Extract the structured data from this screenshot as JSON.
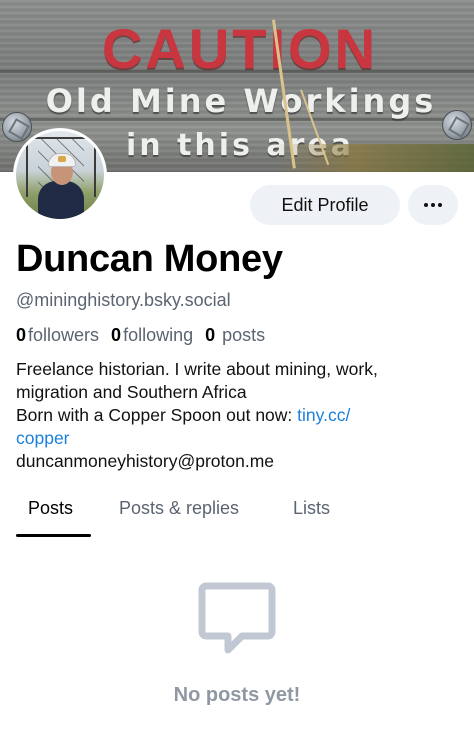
{
  "banner": {
    "sign_line1": "CAUTION",
    "sign_line2": "Old Mine Workings",
    "sign_line3": "in this area",
    "colors": {
      "caution_red": "#c9363f",
      "wood": "#7a7d7b"
    }
  },
  "profile": {
    "avatar": "avatar-photo-miner-helmet",
    "display_name": "Duncan Money",
    "handle": "@mininghistory.bsky.social",
    "stats": {
      "followers_count": "0",
      "followers_label": "followers",
      "following_count": "0",
      "following_label": "following",
      "posts_count": "0",
      "posts_label": "posts"
    },
    "bio": {
      "line1": "Freelance historian. I write about mining, work,",
      "line2": "migration and Southern Africa",
      "line3_text": "Born with a Copper Spoon out now: ",
      "line3_link": "tiny.cc/",
      "line4_link": "copper",
      "line5": "duncanmoneyhistory@proton.me"
    }
  },
  "actions": {
    "edit_profile_label": "Edit Profile",
    "more_icon": "ellipsis-icon"
  },
  "tabs": [
    {
      "label": "Posts",
      "active": true
    },
    {
      "label": "Posts & replies",
      "active": false
    },
    {
      "label": "Lists",
      "active": false
    }
  ],
  "empty_state": {
    "icon": "message-bubble-icon",
    "text": "No posts yet!"
  },
  "theme": {
    "link_color": "#1d7fde",
    "muted_text": "#5b6470",
    "button_bg": "#eef1f5"
  }
}
